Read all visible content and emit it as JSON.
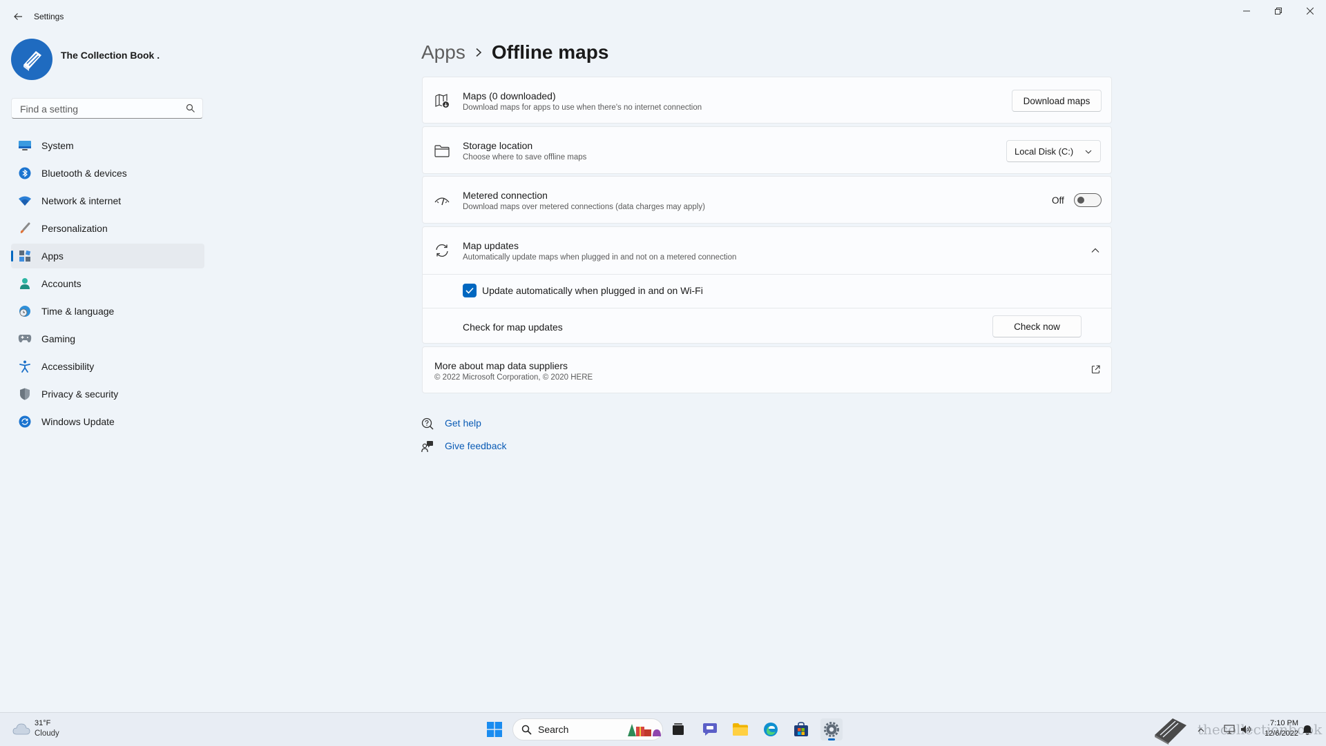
{
  "window": {
    "title": "Settings"
  },
  "profile": {
    "name": "The Collection Book ."
  },
  "search": {
    "placeholder": "Find a setting"
  },
  "sidebar": {
    "items": [
      {
        "label": "System",
        "icon": "monitor-icon"
      },
      {
        "label": "Bluetooth & devices",
        "icon": "bluetooth-icon"
      },
      {
        "label": "Network & internet",
        "icon": "wifi-icon"
      },
      {
        "label": "Personalization",
        "icon": "brush-icon"
      },
      {
        "label": "Apps",
        "icon": "apps-icon",
        "selected": true
      },
      {
        "label": "Accounts",
        "icon": "person-icon"
      },
      {
        "label": "Time & language",
        "icon": "globe-clock-icon"
      },
      {
        "label": "Gaming",
        "icon": "gamepad-icon"
      },
      {
        "label": "Accessibility",
        "icon": "accessibility-icon"
      },
      {
        "label": "Privacy & security",
        "icon": "shield-icon"
      },
      {
        "label": "Windows Update",
        "icon": "update-icon"
      }
    ]
  },
  "breadcrumb": {
    "parent": "Apps",
    "current": "Offline maps"
  },
  "maps": {
    "title": "Maps (0 downloaded)",
    "subtitle": "Download maps for apps to use when there's no internet connection",
    "button": "Download maps"
  },
  "storage": {
    "title": "Storage location",
    "subtitle": "Choose where to save offline maps",
    "selected": "Local Disk (C:)"
  },
  "metered": {
    "title": "Metered connection",
    "subtitle": "Download maps over metered connections (data charges may apply)",
    "state_label": "Off",
    "on": false
  },
  "updates": {
    "title": "Map updates",
    "subtitle": "Automatically update maps when plugged in and not on a metered connection",
    "auto_label": "Update automatically when plugged in and on Wi-Fi",
    "auto_checked": true,
    "check_label": "Check for map updates",
    "check_button": "Check now"
  },
  "suppliers": {
    "title": "More about map data suppliers",
    "subtitle": "© 2022 Microsoft Corporation, © 2020 HERE"
  },
  "help": {
    "get_help": "Get help",
    "give_feedback": "Give feedback"
  },
  "taskbar": {
    "weather_temp": "31°F",
    "weather_cond": "Cloudy",
    "search_label": "Search",
    "time": "7:10 PM",
    "date": "12/6/2022",
    "watermark": "thecollectionbook"
  },
  "colors": {
    "accent": "#0067c0",
    "background": "#eff4f9",
    "card": "#fbfcfe"
  }
}
